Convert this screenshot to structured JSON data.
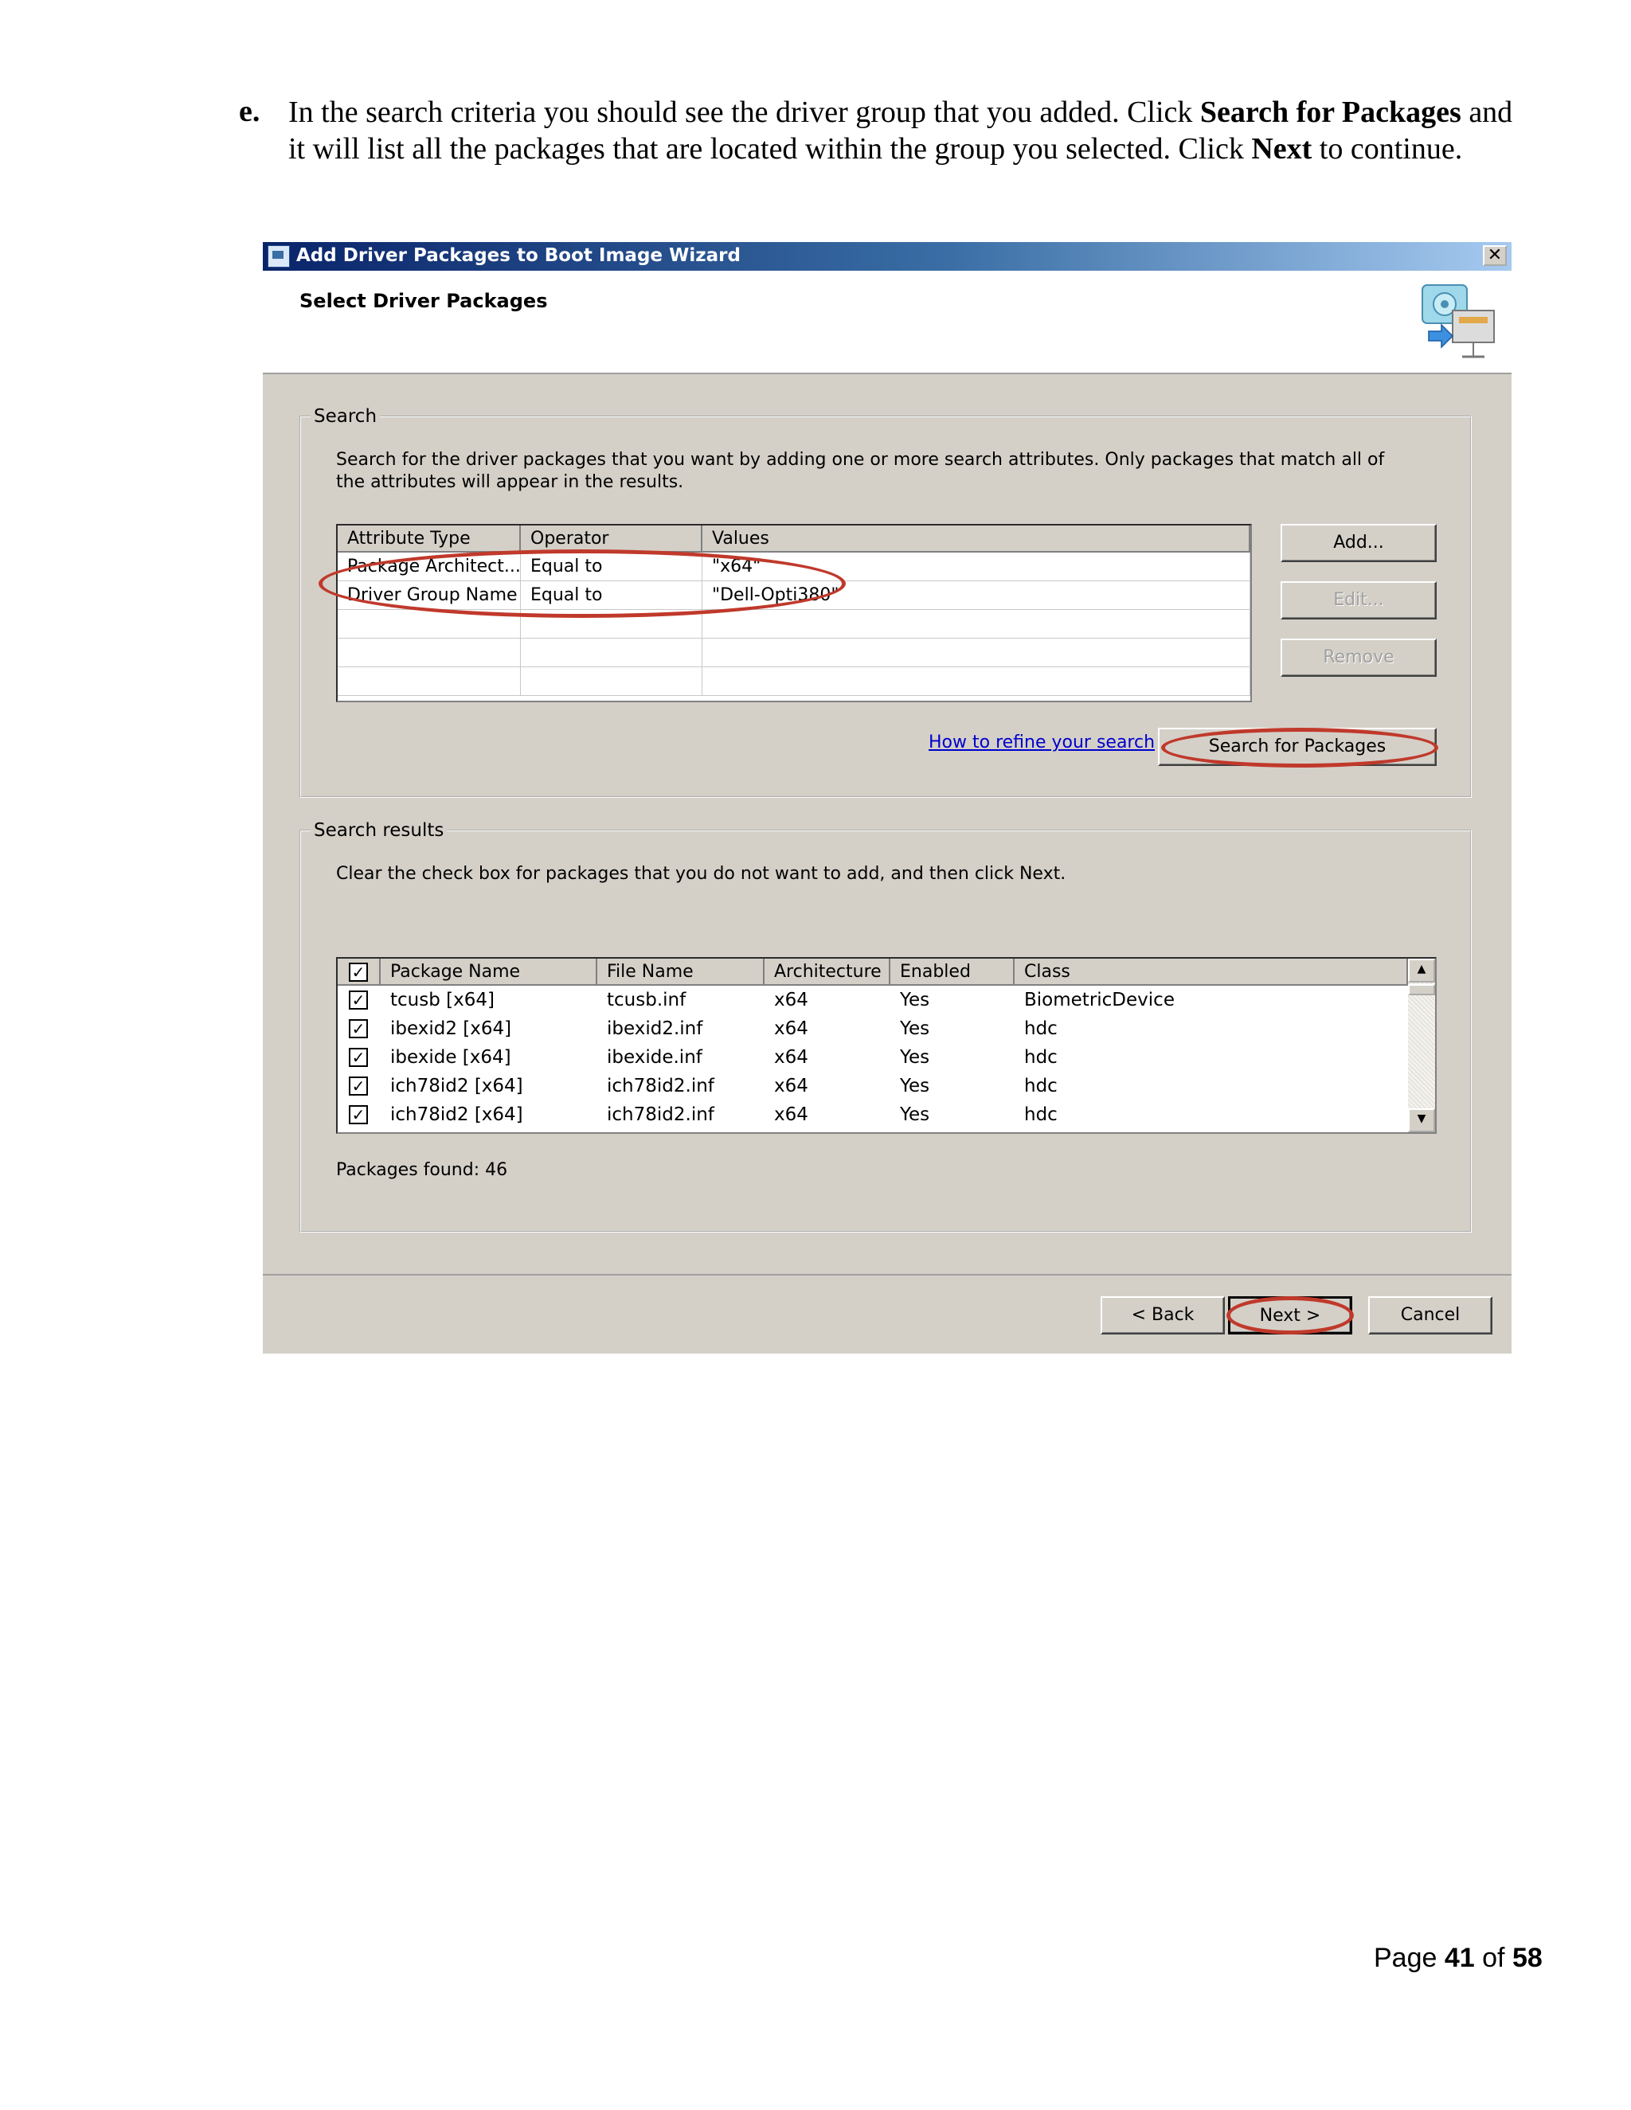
{
  "instruction": {
    "letter": "e.",
    "text_1": "In the search criteria you should see the driver group that you added. Click ",
    "bold_1": "Search for Packages",
    "text_2": " and it will list all the packages that are located within the group you selected. Click ",
    "bold_2": "Next",
    "text_3": " to continue."
  },
  "dialog": {
    "title": "Add Driver Packages to Boot Image Wizard",
    "page_title": "Select Driver Packages",
    "search": {
      "legend": "Search",
      "description": "Search for the driver packages that you want by adding one or more search attributes. Only packages that match all of the attributes will appear in the results.",
      "columns": [
        "Attribute Type",
        "Operator",
        "Values"
      ],
      "rows": [
        [
          "Package Architect...",
          "Equal to",
          "\"x64\""
        ],
        [
          "Driver Group Name",
          "Equal to",
          "\"Dell-Opti380\""
        ]
      ],
      "add_label": "Add...",
      "edit_label": "Edit...",
      "remove_label": "Remove",
      "refine_link": "How to refine your search",
      "search_button": "Search for Packages"
    },
    "results": {
      "legend": "Search results",
      "description": "Clear the check box for packages that you do not want to add, and then click Next.",
      "columns": [
        "Package Name",
        "File Name",
        "Architecture",
        "Enabled",
        "Class"
      ],
      "rows": [
        [
          "tcusb [x64]",
          "tcusb.inf",
          "x64",
          "Yes",
          "BiometricDevice"
        ],
        [
          "ibexid2 [x64]",
          "ibexid2.inf",
          "x64",
          "Yes",
          "hdc"
        ],
        [
          "ibexide [x64]",
          "ibexide.inf",
          "x64",
          "Yes",
          "hdc"
        ],
        [
          "ich78id2 [x64]",
          "ich78id2.inf",
          "x64",
          "Yes",
          "hdc"
        ],
        [
          "ich78id2 [x64]",
          "ich78id2.inf",
          "x64",
          "Yes",
          "hdc"
        ]
      ],
      "check_mark": "✓",
      "packages_found": "Packages found: 46"
    },
    "buttons": {
      "back": "< Back",
      "next": "Next >",
      "cancel": "Cancel"
    },
    "close_symbol": "✕",
    "callout_color": "#c0392b"
  },
  "footer": {
    "page_word": "Page",
    "current": "41",
    "of_word": "of",
    "total": "58"
  }
}
